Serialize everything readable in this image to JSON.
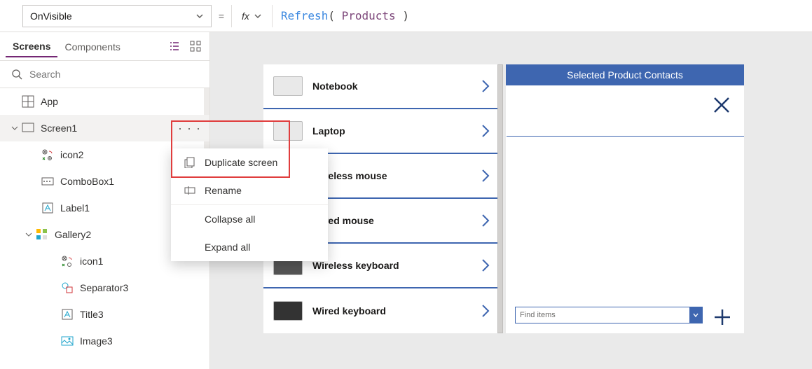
{
  "formula": {
    "property": "OnVisible",
    "equals": "=",
    "fx_label": "fx",
    "fn": "Refresh",
    "open_paren": "(",
    "datasource": "Products",
    "close_paren": ")"
  },
  "tabs": {
    "screens": "Screens",
    "components": "Components"
  },
  "search": {
    "placeholder": "Search"
  },
  "tree": {
    "app": "App",
    "screen1": "Screen1",
    "icon2": "icon2",
    "combobox1": "ComboBox1",
    "label1": "Label1",
    "gallery2": "Gallery2",
    "icon1": "icon1",
    "separator3": "Separator3",
    "title3": "Title3",
    "image3": "Image3"
  },
  "context_menu": {
    "duplicate": "Duplicate screen",
    "rename": "Rename",
    "collapse": "Collapse all",
    "expand": "Expand all"
  },
  "gallery": {
    "items": [
      {
        "label": "Notebook"
      },
      {
        "label": "Laptop"
      },
      {
        "label": "Wireless mouse"
      },
      {
        "label": "Wired mouse"
      },
      {
        "label": "Wireless keyboard"
      },
      {
        "label": "Wired keyboard"
      }
    ]
  },
  "contacts": {
    "header": "Selected Product Contacts",
    "combo_placeholder": "Find items"
  }
}
